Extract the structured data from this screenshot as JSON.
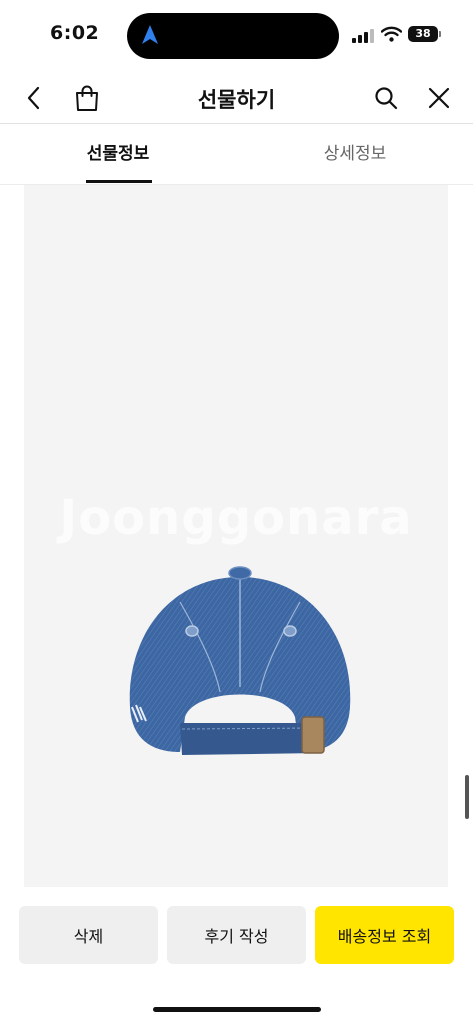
{
  "status_bar": {
    "time": "6:02",
    "battery": "38",
    "icons": [
      "location-arrow-icon",
      "signal-icon",
      "wifi-icon",
      "battery-icon"
    ]
  },
  "header": {
    "title": "선물하기",
    "icons": [
      "chevron-left-icon",
      "shopping-bag-icon",
      "search-icon",
      "close-icon"
    ]
  },
  "tabs": [
    {
      "label": "선물정보",
      "active": true
    },
    {
      "label": "상세정보",
      "active": false
    }
  ],
  "product": {
    "watermark": "Joonggonara",
    "image_subject": "denim baseball cap, back view"
  },
  "actions": {
    "delete_label": "삭제",
    "review_label": "후기 작성",
    "shipping_label": "배송정보 조회"
  },
  "colors": {
    "accent_yellow": "#ffe500",
    "button_gray": "#efefef",
    "image_background": "#f4f4f4",
    "denim": "#3d67a3",
    "location_arrow": "#2f80ed"
  }
}
